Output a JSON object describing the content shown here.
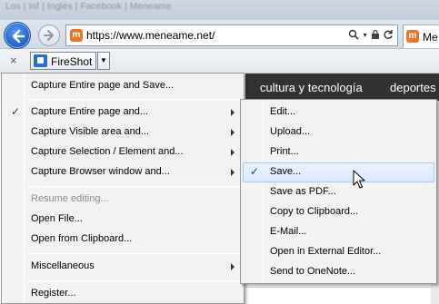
{
  "browser": {
    "background_title": "Los | Inf | Inglés | Facebook | Meneame ",
    "url": "https://www.meneame.net/",
    "tab_label": "Me",
    "site_icon_letter": "m"
  },
  "toolbar": {
    "close_glyph": "×",
    "fireshot_label": "FireShot",
    "dropdown_glyph": "▼"
  },
  "site": {
    "nav_items": [
      "cultura y tecnología",
      "deportes"
    ]
  },
  "main_menu": {
    "items": [
      {
        "label": "Capture Entire page and Save..."
      },
      {
        "label": "Capture Entire page and...",
        "checked": true,
        "submenu": true
      },
      {
        "label": "Capture Visible area and...",
        "submenu": true
      },
      {
        "label": "Capture Selection / Element and...",
        "submenu": true
      },
      {
        "label": "Capture Browser window and...",
        "submenu": true
      },
      {
        "label": "Resume editing...",
        "disabled": true
      },
      {
        "label": "Open File..."
      },
      {
        "label": "Open from Clipboard..."
      },
      {
        "label": "Miscellaneous",
        "submenu": true
      },
      {
        "label": "Register..."
      }
    ],
    "check_glyph": "✓"
  },
  "sub_menu": {
    "items": [
      {
        "label": "Edit..."
      },
      {
        "label": "Upload..."
      },
      {
        "label": "Print..."
      },
      {
        "label": "Save...",
        "checked": true,
        "highlighted": true
      },
      {
        "label": "Save as PDF..."
      },
      {
        "label": "Copy to Clipboard..."
      },
      {
        "label": "E-Mail..."
      },
      {
        "label": "Open in External Editor..."
      },
      {
        "label": "Send to OneNote..."
      }
    ]
  },
  "colors": {
    "site_bar": "#323232",
    "menu_bg": "#f2f2f2",
    "highlight_border": "#a8c8ec",
    "back_button": "#1f62c5"
  }
}
